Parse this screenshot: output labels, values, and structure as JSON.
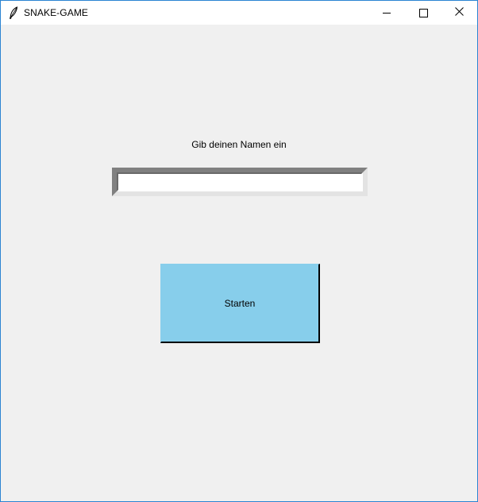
{
  "window": {
    "title": "SNAKE-GAME",
    "icon": "feather-icon",
    "controls": {
      "minimize": "minimize-icon",
      "maximize": "maximize-icon",
      "close": "close-icon"
    }
  },
  "form": {
    "prompt_label": "Gib deinen Namen ein",
    "name_value": "",
    "start_label": "Starten"
  },
  "colors": {
    "window_border": "#2b84d2",
    "background": "#f0f0f0",
    "start_button": "#87ceeb"
  }
}
